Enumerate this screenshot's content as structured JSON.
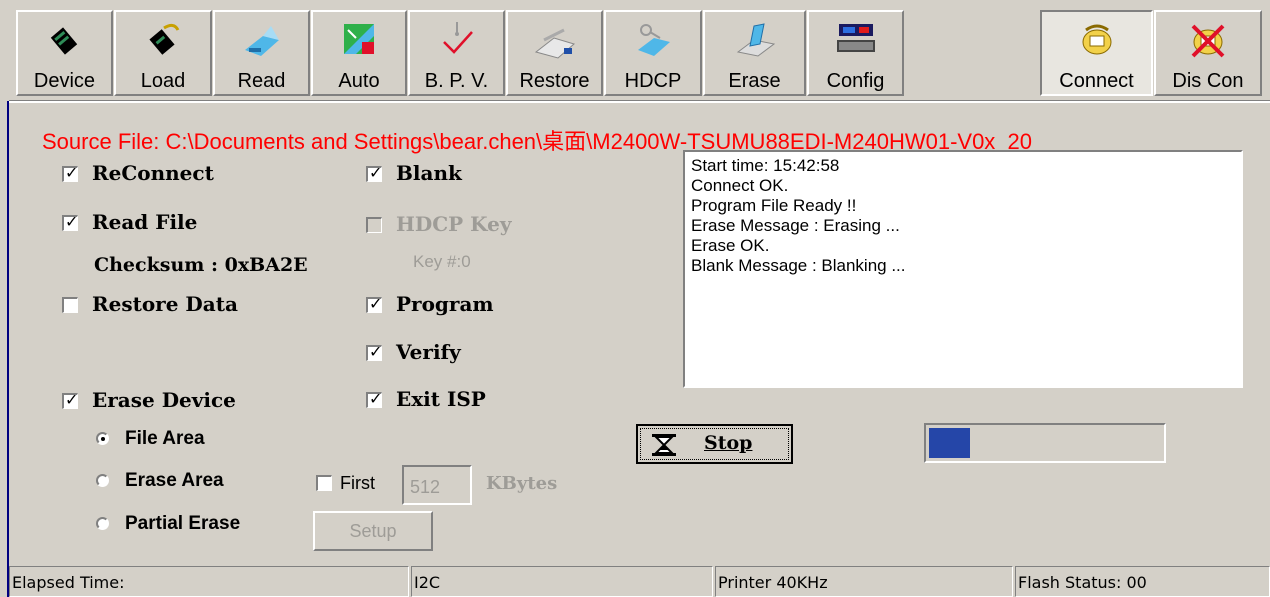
{
  "toolbar": {
    "buttons": [
      {
        "label": "Device",
        "icon": "chip-icon"
      },
      {
        "label": "Load",
        "icon": "load-chip-icon"
      },
      {
        "label": "Read",
        "icon": "read-icon"
      },
      {
        "label": "Auto",
        "icon": "auto-icon"
      },
      {
        "label": "B. P. V.",
        "icon": "bpv-check-icon"
      },
      {
        "label": "Restore",
        "icon": "restore-icon"
      },
      {
        "label": "HDCP",
        "icon": "hdcp-key-icon"
      },
      {
        "label": "Erase",
        "icon": "erase-icon"
      },
      {
        "label": "Config",
        "icon": "config-computer-icon"
      },
      {
        "label": "Connect",
        "icon": "connect-phone-icon"
      },
      {
        "label": "Dis Con",
        "icon": "disconnect-phone-icon"
      }
    ],
    "active": "Connect"
  },
  "source_file": "Source File: C:\\Documents and Settings\\bear.chen\\桌面\\M2400W-TSUMU88EDI-M240HW01-V0x_20",
  "options": {
    "reconnect": {
      "label": "ReConnect",
      "checked": true
    },
    "read_file": {
      "label": "Read File",
      "checked": true
    },
    "checksum": "Checksum : 0xBA2E",
    "restore_data": {
      "label": "Restore Data",
      "checked": false
    },
    "erase_device": {
      "label": "Erase Device",
      "checked": true
    },
    "blank": {
      "label": "Blank",
      "checked": true
    },
    "hdcp_key": {
      "label": "HDCP Key",
      "checked": false,
      "disabled": true
    },
    "key_num": "Key #:0",
    "program": {
      "label": "Program",
      "checked": true
    },
    "verify": {
      "label": "Verify",
      "checked": true
    },
    "exit_isp": {
      "label": "Exit ISP",
      "checked": true
    }
  },
  "erase_mode": {
    "file_area": {
      "label": "File Area",
      "selected": true
    },
    "erase_area": {
      "label": "Erase Area",
      "selected": false
    },
    "partial_erase": {
      "label": "Partial Erase",
      "selected": false
    }
  },
  "first": {
    "label": "First",
    "checked": false,
    "value": "512",
    "unit": "KBytes"
  },
  "setup_label": "Setup",
  "log": [
    "Start time: 15:42:58",
    "Connect OK.",
    "Program File Ready !!",
    "Erase Message : Erasing ...",
    "Erase OK.",
    "Blank Message : Blanking ..."
  ],
  "stop_label": "Stop",
  "progress": {
    "fraction": 0.08,
    "color": "#2546a8"
  },
  "status": {
    "elapsed": "Elapsed Time:",
    "interface": "I2C",
    "printer": "Printer  40KHz",
    "flash": "Flash Status: 00"
  }
}
